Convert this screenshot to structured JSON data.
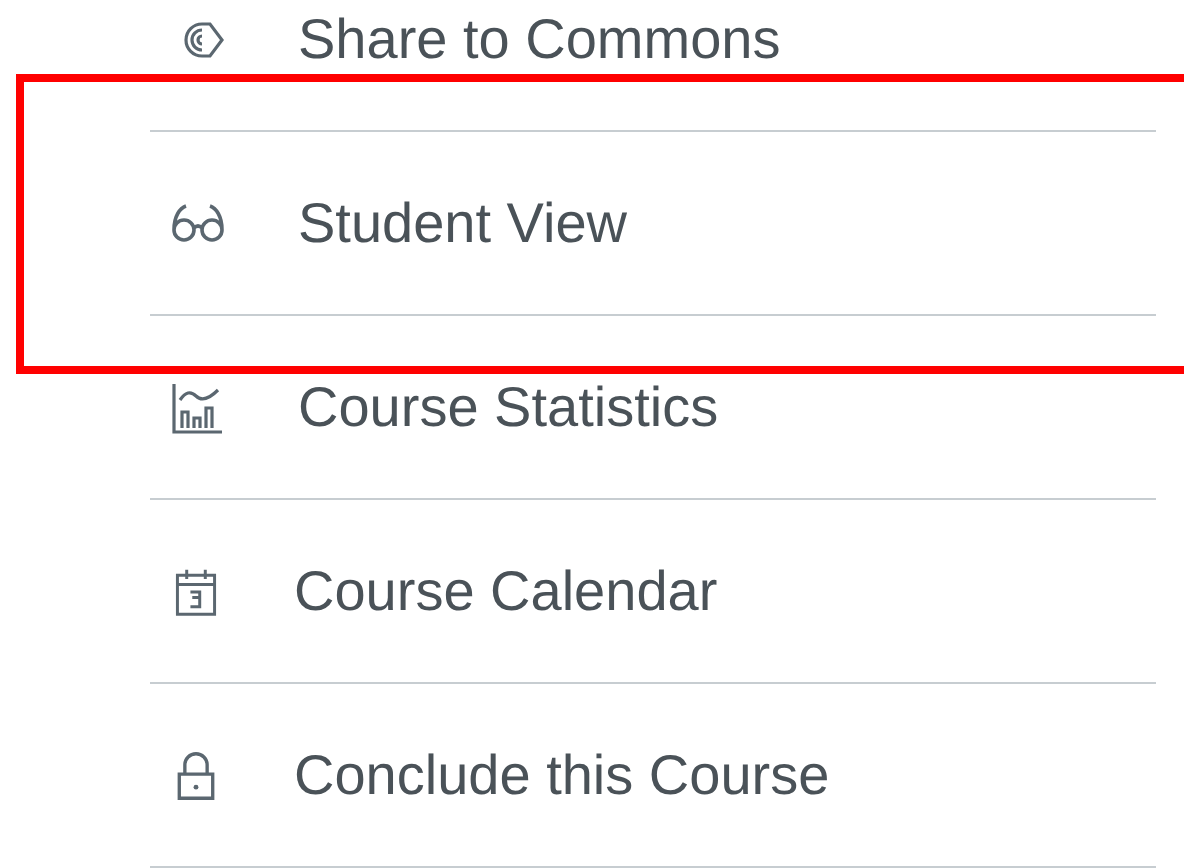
{
  "menu": {
    "items": [
      {
        "label": "Share to Commons",
        "kind": "share",
        "highlighted": false
      },
      {
        "label": "Student View",
        "kind": "preview",
        "highlighted": true
      },
      {
        "label": "Course Statistics",
        "kind": "stats",
        "highlighted": false
      },
      {
        "label": "Course Calendar",
        "kind": "calendar",
        "highlighted": false
      },
      {
        "label": "Conclude this Course",
        "kind": "conclude",
        "highlighted": false
      }
    ]
  }
}
